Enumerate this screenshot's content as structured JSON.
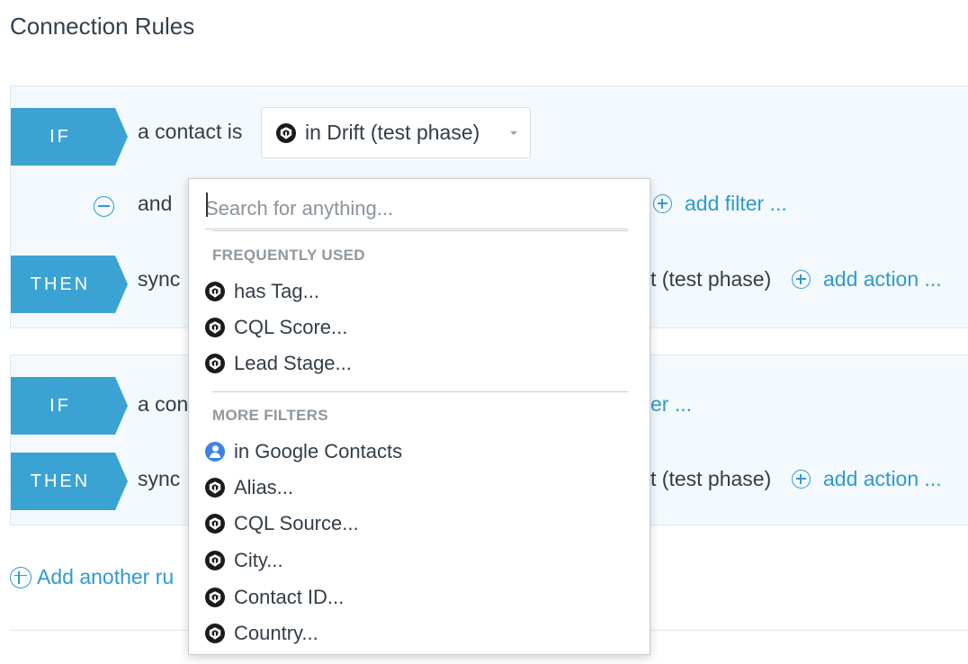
{
  "page": {
    "title": "Connection Rules"
  },
  "rule1": {
    "if_label": "IF",
    "then_label": "THEN",
    "condition_text": "a contact is",
    "selected_source": "in Drift (test phase)",
    "and_label": "and",
    "add_filter": "add filter ...",
    "then_prefix": "sync",
    "then_suffix": "t (test phase)",
    "add_action": "add action ..."
  },
  "rule2": {
    "if_label": "IF",
    "then_label": "THEN",
    "condition_prefix": "a con",
    "filter_fragment": "er ...",
    "then_prefix": "sync",
    "then_suffix": "t (test phase)",
    "add_action": "add action ..."
  },
  "add_rule": {
    "label": "Add another ru"
  },
  "dropdown": {
    "search_placeholder": "Search for anything...",
    "sections": [
      {
        "title": "FREQUENTLY USED",
        "items": [
          {
            "label": "has Tag...",
            "icon": "drift-icon"
          },
          {
            "label": "CQL Score...",
            "icon": "drift-icon"
          },
          {
            "label": "Lead Stage...",
            "icon": "drift-icon"
          }
        ]
      },
      {
        "title": "MORE FILTERS",
        "items": [
          {
            "label": "in Google Contacts",
            "icon": "google-contacts-icon"
          },
          {
            "label": "Alias...",
            "icon": "drift-icon"
          },
          {
            "label": "CQL Source...",
            "icon": "drift-icon"
          },
          {
            "label": "City...",
            "icon": "drift-icon"
          },
          {
            "label": "Contact ID...",
            "icon": "drift-icon"
          },
          {
            "label": "Country...",
            "icon": "drift-icon"
          }
        ]
      }
    ]
  },
  "colors": {
    "accent": "#3aa3d3",
    "link": "#2f9ad0",
    "rule_bg": "#f3f9fc"
  }
}
